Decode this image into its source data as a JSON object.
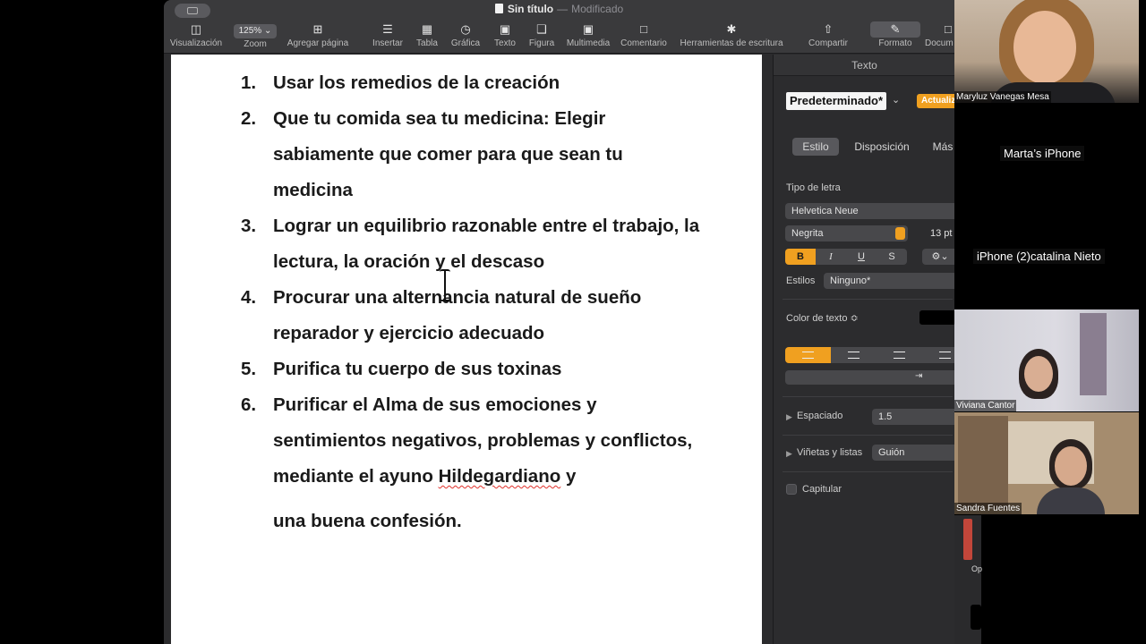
{
  "window": {
    "title": "Sin título",
    "separator": "—",
    "status": "Modificado"
  },
  "toolbar": {
    "zoom_value": "125%",
    "items": [
      {
        "label": "Visualización",
        "icon": "sidebar-icon"
      },
      {
        "label": "Zoom",
        "icon": "zoom-icon"
      },
      {
        "label": "Agregar página",
        "icon": "add-page-icon"
      },
      {
        "label": "Insertar",
        "icon": "insert-list-icon"
      },
      {
        "label": "Tabla",
        "icon": "table-icon"
      },
      {
        "label": "Gráfica",
        "icon": "chart-icon"
      },
      {
        "label": "Texto",
        "icon": "text-box-icon"
      },
      {
        "label": "Figura",
        "icon": "shape-icon"
      },
      {
        "label": "Multimedia",
        "icon": "media-icon"
      },
      {
        "label": "Comentario",
        "icon": "comment-icon"
      },
      {
        "label": "Herramientas de escritura",
        "icon": "writing-tools-icon"
      },
      {
        "label": "Compartir",
        "icon": "share-icon"
      },
      {
        "label": "Formato",
        "icon": "format-brush-icon"
      },
      {
        "label": "Docum",
        "icon": "document-icon"
      }
    ]
  },
  "document": {
    "items": [
      {
        "num": "1.",
        "text": "Usar los remedios de la creación"
      },
      {
        "num": "2.",
        "text": "Que tu comida sea tu medicina: Elegir sabiamente que comer para que sean tu medicina"
      },
      {
        "num": "3.",
        "text": "Lograr un equilibrio razonable entre el trabajo, la lectura, la oración y el descaso"
      },
      {
        "num": "4.",
        "text": "Procurar una alternancia natural de sueño reparador y ejercicio adecuado"
      },
      {
        "num": "5.",
        "text": "Purifica tu cuerpo de sus toxinas"
      },
      {
        "num": "6.",
        "text_part1": "Purificar el Alma de sus emociones y sentimientos negativos, problemas y conflictos, mediante el ayuno ",
        "misspelled": "Hildegardiano",
        "text_part2": " y",
        "text_tail": "una buena confesión."
      }
    ]
  },
  "inspector": {
    "header": "Texto",
    "paragraph_style": "Predeterminado*",
    "update_button": "Actualiz",
    "tabs": [
      "Estilo",
      "Disposición",
      "Más"
    ],
    "active_tab": "Estilo",
    "font_section_label": "Tipo de letra",
    "font_family": "Helvetica Neue",
    "font_weight": "Negrita",
    "font_size": "13 pt",
    "bold": "B",
    "italic": "I",
    "underline": "U",
    "strikethrough": "S",
    "char_styles_label": "Estilos",
    "char_styles_value": "Ninguno*",
    "text_color_label": "Color de texto ≎",
    "text_color": "#000000",
    "spacing_label": "Espaciado",
    "spacing_value": "1.5",
    "bullets_label": "Viñetas y listas",
    "bullets_value": "Guión",
    "dropcap_label": "Capitular"
  },
  "participants": [
    {
      "name": "Maryluz Vanegas Mesa"
    },
    {
      "name": "Marta’s iPhone"
    },
    {
      "name": "iPhone (2)catalina Nieto"
    },
    {
      "name": "Viviana Cantor"
    },
    {
      "name": "Sandra Fuentes"
    }
  ],
  "overlay_fragment": "Op",
  "colors": {
    "accent": "#f0a020",
    "toolbar_bg": "#3a3a3c",
    "inspector_bg": "#2c2c2e",
    "spelling_underline": "#e0302a"
  }
}
